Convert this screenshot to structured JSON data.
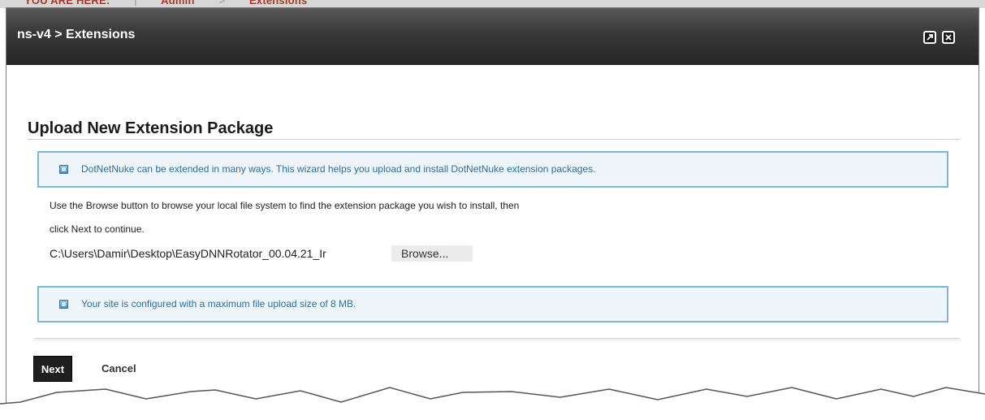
{
  "background_breadcrumb": {
    "prefix": "YOU ARE HERE:",
    "items": [
      "Admin",
      "Extensions"
    ]
  },
  "dialog": {
    "title": "ns-v4 > Extensions",
    "maximize_icon": "maximize-icon",
    "close_icon": "close-icon"
  },
  "wizard": {
    "heading": "Upload New Extension Package",
    "info_intro": "DotNetNuke can be extended in many ways. This wizard helps you upload and install DotNetNuke extension packages.",
    "instruction_line1": "Use the Browse button to browse your local file system to find the extension package you wish to install, then",
    "instruction_line2": "click Next to continue.",
    "file_path": "C:\\Users\\Damir\\Desktop\\EasyDNNRotator_00.04.21_Ir",
    "browse_label": "Browse...",
    "info_upload_limit": "Your site is configured with a maximum file upload size of 8 MB.",
    "next_label": "Next",
    "cancel_label": "Cancel"
  },
  "colors": {
    "titlebar": "#2b2b2b",
    "info_border": "#7eb6d4",
    "info_text": "#2b6fa3",
    "breadcrumb": "#a33a2a"
  }
}
